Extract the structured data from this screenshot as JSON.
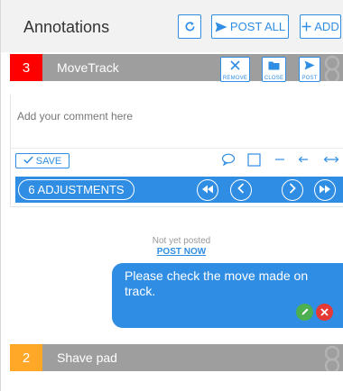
{
  "header": {
    "title": "Annotations",
    "refresh_icon": "refresh-icon",
    "post_all_label": "POST ALL",
    "add_label": "ADD"
  },
  "annotations": [
    {
      "number": "3",
      "name": "MoveTrack",
      "color": "#ff0000",
      "actions": {
        "remove_label": "REMOVE",
        "close_label": "CLOSE",
        "post_label": "POST"
      },
      "comment": {
        "placeholder": "Add your comment here",
        "save_label": "SAVE",
        "tools": [
          "speech-bubble-icon",
          "square-icon",
          "line-icon",
          "arrow-left-icon",
          "double-arrow-icon"
        ]
      },
      "adjustments_label": "6 ADJUSTMENTS",
      "thread": {
        "status": "Not yet posted",
        "post_now_label": "POST NOW",
        "message": "Please check the move made on track."
      }
    },
    {
      "number": "2",
      "name": "Shave pad",
      "color": "#ffa726"
    }
  ],
  "colors": {
    "accent": "#2f8de4",
    "bar_gray": "#9e9e9e",
    "header_bg": "#f2f2f2",
    "confirm_green": "#4caf50",
    "cancel_red": "#e53935"
  }
}
